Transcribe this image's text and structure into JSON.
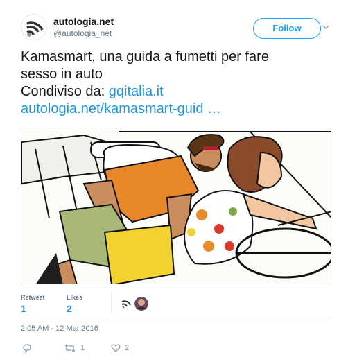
{
  "account": {
    "name": "autologia.net",
    "handle": "@autologia_net",
    "avatar_icon": "wifi-signal-logo-icon"
  },
  "follow_button": {
    "label": "Follow"
  },
  "tweet": {
    "line1": "Kamasmart, una guida a fumetti per fare",
    "line2": "sesso in auto",
    "line3_prefix": "Condiviso da: ",
    "line3_link": "gqitalia.it",
    "line4_link": "autologia.net/kamasmart-guid …"
  },
  "media": {
    "icon": "comic-illustration-couple-in-car"
  },
  "stats": {
    "retweets_label": "Retweet",
    "retweets_value": "1",
    "likes_label": "Likes",
    "likes_value": "2"
  },
  "timestamp": "2:05 AM - 12 Mar 2016",
  "actions": {
    "reply_icon": "reply-icon",
    "retweet_icon": "retweet-icon",
    "retweet_count": "1",
    "like_icon": "heart-icon",
    "like_count": "2"
  },
  "colors": {
    "link": "#1b95e0",
    "follow_blue": "#1da1f2",
    "secondary": "#657786",
    "action_gray": "#8899a6"
  }
}
